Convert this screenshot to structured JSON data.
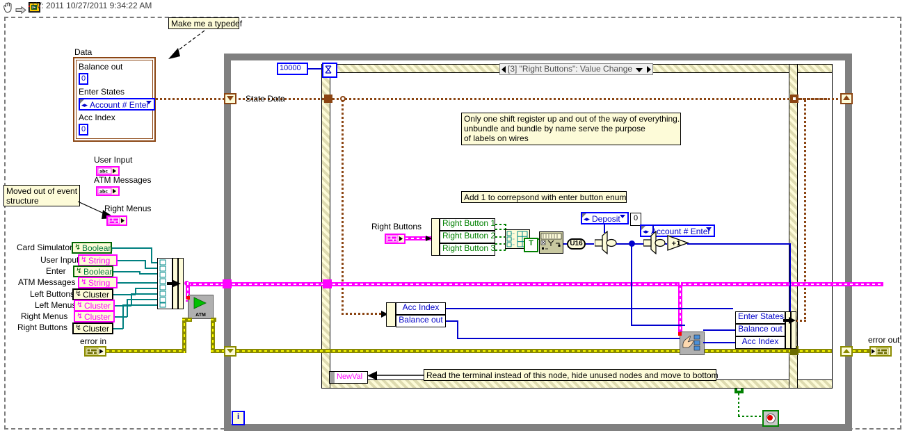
{
  "window": {
    "status_text": "LV: 2011 10/27/2011 9:34:22 AM",
    "icons": [
      "hand-cursor-icon",
      "run-arrow-icon",
      "labview-vi-icon"
    ]
  },
  "comments": [
    {
      "id": "typedef",
      "text": "Make me a typedef"
    },
    {
      "id": "movedout",
      "text": "Moved out of event\nstructure"
    },
    {
      "id": "shiftreg",
      "text": "Only one shift register up and out of the way of everything.\nunbundle and bundle by name serve the purpose\nof labels on wires"
    },
    {
      "id": "add1",
      "text": "Add 1 to correpsond with enter button enum"
    },
    {
      "id": "readterm",
      "text": "Read the terminal instead of this node, hide unused nodes and move to bottom"
    }
  ],
  "data_cluster": {
    "label": "Data",
    "fields": [
      {
        "name": "Balance out",
        "value": "0"
      },
      {
        "name": "Enter States",
        "value": "Account # Enter"
      },
      {
        "name": "Acc Index",
        "value": "0"
      }
    ]
  },
  "front_panel_terminals": [
    {
      "label": "User Input",
      "type": "abc"
    },
    {
      "label": "ATM Messages",
      "type": "abc"
    },
    {
      "label": "Right Menus",
      "type": "cluster"
    }
  ],
  "control_refs": [
    {
      "label": "Card Simulator",
      "type": "Boolean"
    },
    {
      "label": "User Input",
      "type": "String"
    },
    {
      "label": "Enter",
      "type": "Boolean"
    },
    {
      "label": "ATM Messages",
      "type": "String"
    },
    {
      "label": "Left Buttons",
      "type": "Cluster"
    },
    {
      "label": "Left Menus",
      "type": "Cluster"
    },
    {
      "label": "Right Menus",
      "type": "Cluster"
    },
    {
      "label": "Right Buttons",
      "type": "Cluster"
    }
  ],
  "error_in_label": "error in",
  "error_out_label": "error out",
  "subvi": {
    "label": "ATM"
  },
  "loop": {
    "timeout_value": "10000",
    "iteration_label": "i",
    "stop_label": "stop-button"
  },
  "event_case": {
    "selector": "[3] \"Right Buttons\": Value Change"
  },
  "shift_register_label": "State Data",
  "right_buttons": {
    "label": "Right Buttons",
    "elements": [
      "Right Button 1",
      "Right Button 2",
      "Right Button 3"
    ]
  },
  "nodes": {
    "u16_label": "U16",
    "enum_deposit": "Deposit",
    "enum_account": "Account # Enter",
    "zero_const": "0",
    "increment": "+1",
    "bool_true": "T"
  },
  "unbundle_state": {
    "elements": [
      "Acc Index",
      "Balance out"
    ]
  },
  "bundle_state": {
    "elements": [
      "Enter States",
      "Balance out",
      "Acc Index"
    ]
  },
  "newval_node": {
    "label": "NewVal"
  },
  "colors": {
    "wire_cluster": "#ff00ff",
    "wire_error": "#8a8a00",
    "wire_numeric": "#0000cd",
    "wire_boolean": "#008000",
    "wire_typedef": "#8b4513",
    "structure_gray": "#808080",
    "comment_bg": "#fdfbd8"
  }
}
